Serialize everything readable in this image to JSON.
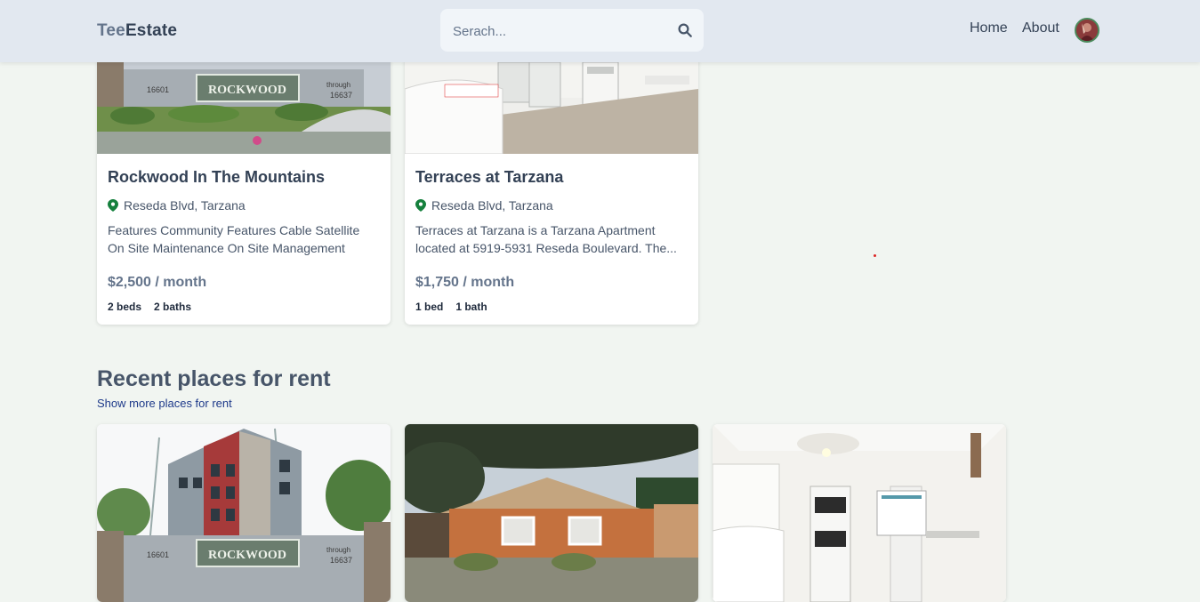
{
  "header": {
    "logo_part1": "Tee",
    "logo_part2": "Estate",
    "search_placeholder": "Serach...",
    "nav": [
      "Home",
      "About"
    ]
  },
  "top_cards": [
    {
      "title": "Rockwood In The Mountains",
      "address": "Reseda Blvd, Tarzana",
      "description": "Features Community Features Cable Satellite On Site Maintenance On Site Management",
      "price": "$2,500 / month",
      "beds": "2 beds",
      "baths": "2 baths"
    },
    {
      "title": "Terraces at Tarzana",
      "address": "Reseda Blvd, Tarzana",
      "description": "Terraces at Tarzana is a Tarzana Apartment located at 5919-5931 Reseda Boulevard. The...",
      "price": "$1,750 / month",
      "beds": "1 bed",
      "baths": "1 bath"
    }
  ],
  "recent": {
    "title": "Recent places for rent",
    "link": "Show more places for rent"
  },
  "colors": {
    "page_bg": "#f1f5f1",
    "header_bg": "#e2e8f0",
    "pin_green": "#15803d",
    "link_blue": "#1e3a8a"
  }
}
